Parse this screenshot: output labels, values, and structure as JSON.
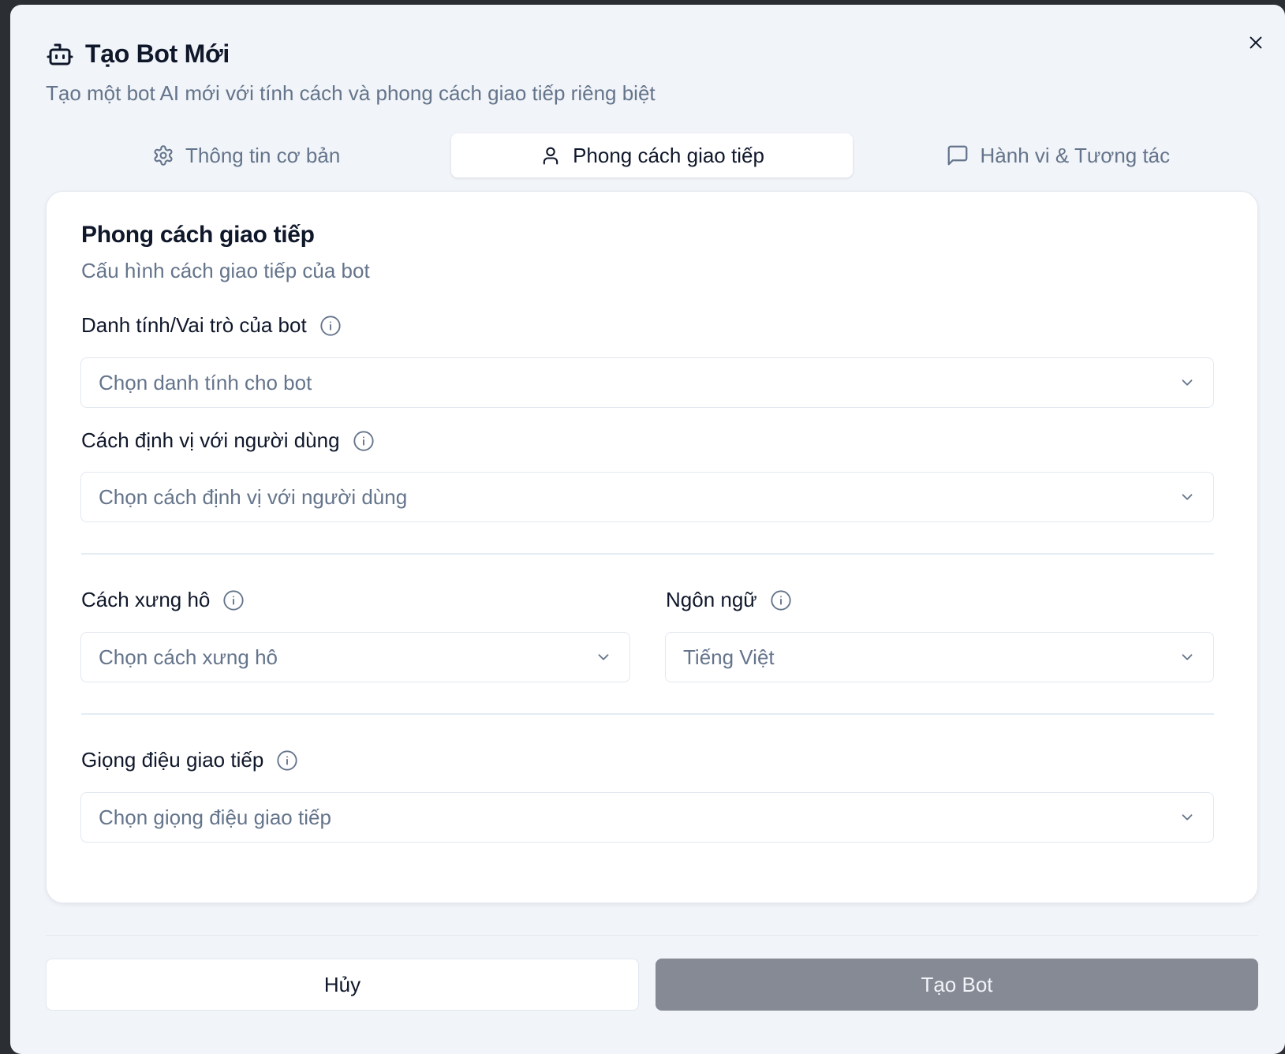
{
  "dialog": {
    "title": "Tạo Bot Mới",
    "subtitle": "Tạo một bot AI mới với tính cách và phong cách giao tiếp riêng biệt",
    "close_icon": "x-icon"
  },
  "tabs": [
    {
      "label": "Thông tin cơ bản",
      "icon": "gear-icon",
      "active": false
    },
    {
      "label": "Phong cách giao tiếp",
      "icon": "user-icon",
      "active": true
    },
    {
      "label": "Hành vi & Tương tác",
      "icon": "message-square-icon",
      "active": false
    }
  ],
  "section": {
    "title": "Phong cách giao tiếp",
    "description": "Cấu hình cách giao tiếp của bot"
  },
  "fields": {
    "identity": {
      "label": "Danh tính/Vai trò của bot",
      "placeholder": "Chọn danh tính cho bot"
    },
    "positioning": {
      "label": "Cách định vị với người dùng",
      "placeholder": "Chọn cách định vị với người dùng"
    },
    "addressing": {
      "label": "Cách xưng hô",
      "placeholder": "Chọn cách xưng hô"
    },
    "language": {
      "label": "Ngôn ngữ",
      "value": "Tiếng Việt"
    },
    "tone": {
      "label": "Giọng điệu giao tiếp",
      "placeholder": "Chọn giọng điệu giao tiếp"
    }
  },
  "footer": {
    "cancel_label": "Hủy",
    "create_label": "Tạo Bot"
  },
  "colors": {
    "background": "#f1f4f8",
    "card": "#ffffff",
    "text_primary": "#0f172a",
    "text_muted": "#64748b",
    "create_button_disabled": "#868a94"
  }
}
